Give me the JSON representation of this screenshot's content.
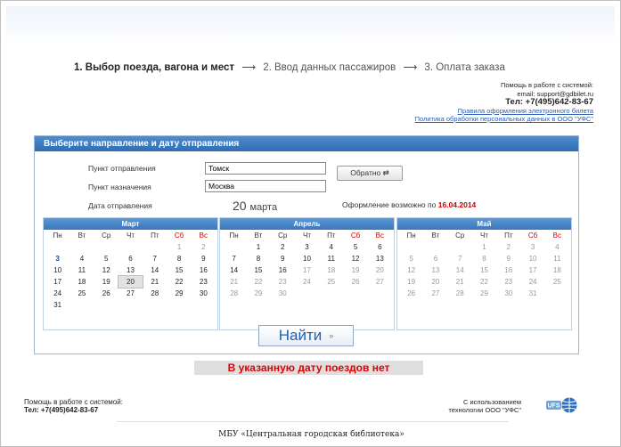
{
  "steps": [
    {
      "label": "1. Выбор поезда, вагона и мест"
    },
    {
      "label": "2. Ввод данных пассажиров"
    },
    {
      "label": "3. Оплата заказа"
    }
  ],
  "help_top": {
    "line1": "Помощь в работе с системой:",
    "email": "email: support@gdbilet.ru",
    "phone": "Тел: +7(495)642-83-67",
    "link1": "Правила оформления электронного билета",
    "link2": "Политика обработки персональных данных в ООО \"УФС\""
  },
  "panel": {
    "title": "Выберите направление и дату отправления",
    "from_label": "Пункт отправления",
    "from_value": "Томск",
    "to_label": "Пункт назначения",
    "to_value": "Москва",
    "swap_label": "Обратно ⇄",
    "date_label": "Дата отправления",
    "date_day": "20",
    "date_month": "марта",
    "possible_prefix": "Оформление возможно по",
    "possible_date": "16.04.2014",
    "find_label": "Найти",
    "find_icon": "chevron-down-double-icon"
  },
  "weekdays": [
    "Пн",
    "Вт",
    "Ср",
    "Чт",
    "Пт",
    "Сб",
    "Вс"
  ],
  "calendars": [
    {
      "month": "Март",
      "offset": 5,
      "days": 31,
      "past_before": 3,
      "today": 3,
      "selected": 20
    },
    {
      "month": "Апрель",
      "offset": 1,
      "days": 30,
      "past_from": 17
    },
    {
      "month": "Май",
      "offset": 3,
      "days": 31,
      "past_from": 1
    }
  ],
  "notice": "В указанную дату поездов нет",
  "help_bottom": {
    "line1": "Помощь в работе с системой:",
    "phone": "Тел: +7(495)642-83-67"
  },
  "tech": {
    "line1": "С использованием",
    "line2": "технологии ООО \"УФС\"",
    "logo_text": "UFS"
  },
  "footer": "МБУ «Центральная городская библиотека»",
  "colors": {
    "header_blue": "#2f6db3",
    "deadline_red": "#d40000",
    "notice_red": "#e00000",
    "link_blue": "#2a5db0"
  }
}
